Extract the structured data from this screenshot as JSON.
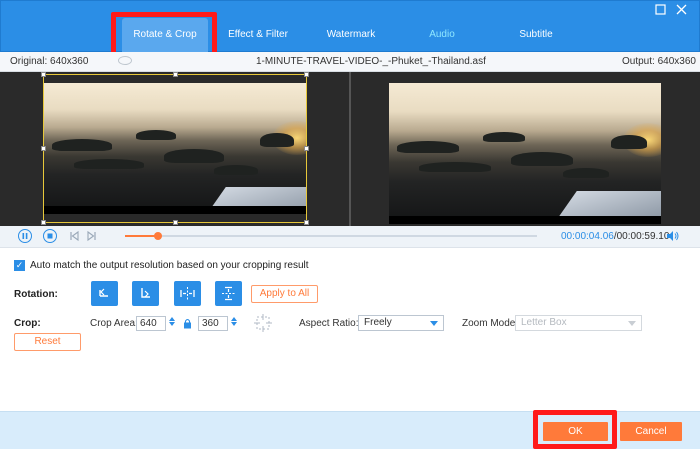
{
  "tabs": [
    {
      "label": "Rotate & Crop",
      "active": true
    },
    {
      "label": "Effect & Filter",
      "active": false
    },
    {
      "label": "Watermark",
      "active": false
    },
    {
      "label": "Audio",
      "active": false
    },
    {
      "label": "Subtitle",
      "active": false
    }
  ],
  "window": {
    "maximize_icon": "maximize-icon",
    "close_icon": "close-icon"
  },
  "file": {
    "original": "Original: 640x360",
    "name": "1-MINUTE-TRAVEL-VIDEO-_-Phuket_-Thailand.asf",
    "output": "Output: 640x360"
  },
  "playback": {
    "current": "00:00:04.06",
    "total": "/00:00:59.10",
    "progress": 0.08
  },
  "settings": {
    "auto_match": "Auto match the output resolution based on your cropping result",
    "auto_match_checked": true,
    "rotation_label": "Rotation:",
    "apply_all": "Apply to All",
    "crop_label": "Crop:",
    "crop_area_label": "Crop Area:",
    "crop_width": "640",
    "crop_height": "360",
    "aspect_label": "Aspect Ratio:",
    "aspect_value": "Freely",
    "zoom_label": "Zoom Mode:",
    "zoom_value": "Letter Box",
    "reset": "Reset"
  },
  "footer": {
    "ok": "OK",
    "cancel": "Cancel"
  },
  "colors": {
    "accent": "#2b8ee6",
    "orange": "#ff7a3a",
    "highlight": "#ff1a1a"
  }
}
